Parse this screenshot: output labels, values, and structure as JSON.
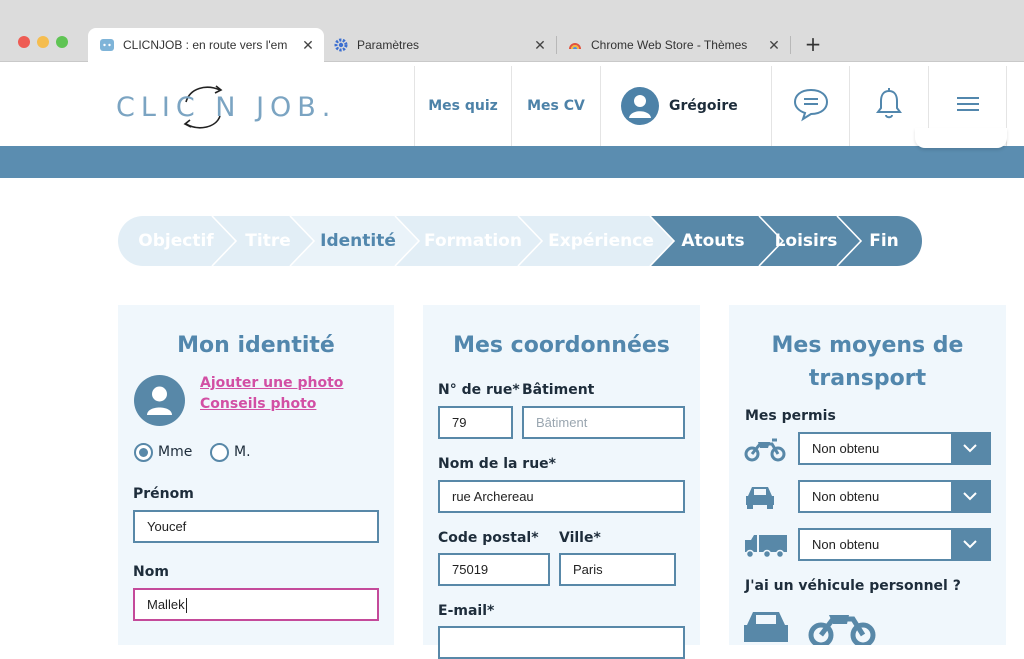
{
  "browser": {
    "tabs": [
      {
        "title": "CLICNJOB : en route vers l'em",
        "active": true
      },
      {
        "title": "Paramètres",
        "active": false
      },
      {
        "title": "Chrome Web Store - Thèmes",
        "active": false
      }
    ],
    "close_glyph": "✕",
    "new_tab_glyph": "+"
  },
  "site": {
    "logo": "CLIC N JOB.",
    "nav": {
      "quiz": "Mes quiz",
      "cv": "Mes CV",
      "user": "Grégoire"
    },
    "icons": [
      "chat-icon",
      "bell-icon",
      "menu-icon"
    ]
  },
  "stepper": {
    "steps": [
      "Objectif",
      "Titre",
      "Identité",
      "Formation",
      "Expérience",
      "Atouts",
      "Loisirs",
      "Fin"
    ],
    "current": "Identité"
  },
  "identity": {
    "title": "Mon identité",
    "add_photo": "Ajouter une photo",
    "photo_tips": "Conseils photo",
    "civility": {
      "mme": "Mme",
      "m": "M.",
      "selected": "Mme"
    },
    "firstname_label": "Prénom",
    "firstname_value": "Youcef",
    "lastname_label": "Nom",
    "lastname_value": "Mallek"
  },
  "contact": {
    "title": "Mes coordonnées",
    "street_no_label": "N° de rue*",
    "street_no_value": "79",
    "building_label": "Bâtiment",
    "building_placeholder": "Bâtiment",
    "street_label": "Nom de la rue*",
    "street_value": "rue Archereau",
    "postal_label": "Code postal*",
    "postal_value": "75019",
    "city_label": "Ville*",
    "city_value": "Paris",
    "email_label": "E-mail*"
  },
  "transport": {
    "title_line1": "Mes moyens de",
    "title_line2": "transport",
    "licenses_label": "Mes permis",
    "licenses": [
      {
        "icon": "motorcycle-icon",
        "value": "Non obtenu"
      },
      {
        "icon": "car-icon",
        "value": "Non obtenu"
      },
      {
        "icon": "truck-icon",
        "value": "Non obtenu"
      }
    ],
    "personal_vehicle_label": "J'ai un véhicule personnel ?"
  },
  "colors": {
    "brand_blue": "#5b8db0",
    "step_done": "#5888a8",
    "step_pending": "#dceaf3",
    "link_pink": "#d24fa4",
    "card_bg": "#f0f7fc"
  }
}
